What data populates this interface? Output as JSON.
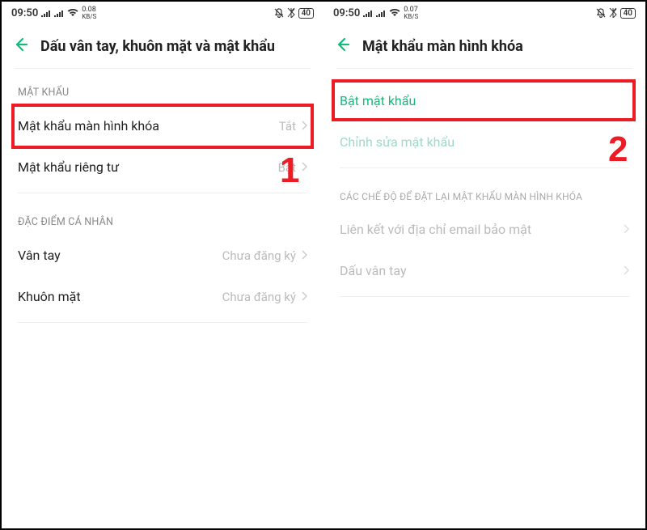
{
  "left": {
    "status": {
      "time": "09:50",
      "kb_top": "0.08",
      "kb_bot": "KB/S",
      "battery": "40"
    },
    "header": {
      "title": "Dấu vân tay, khuôn mặt và mật khẩu"
    },
    "section1": {
      "header": "MẬT KHẨU",
      "item1": {
        "label": "Mật khẩu màn hình khóa",
        "value": "Tắt"
      },
      "item2": {
        "label": "Mật khẩu riêng tư",
        "value": "Bật"
      }
    },
    "section2": {
      "header": "ĐẶC ĐIỂM CÁ NHÂN",
      "item1": {
        "label": "Vân tay",
        "value": "Chưa đăng ký"
      },
      "item2": {
        "label": "Khuôn mặt",
        "value": "Chưa đăng ký"
      }
    },
    "annotation_number": "1"
  },
  "right": {
    "status": {
      "time": "09:50",
      "kb_top": "0.07",
      "kb_bot": "KB/S",
      "battery": "40"
    },
    "header": {
      "title": "Mật khẩu màn hình khóa"
    },
    "item1": {
      "label": "Bật mật khẩu"
    },
    "item2": {
      "label": "Chỉnh sửa mật khẩu"
    },
    "section2": {
      "header": "CÁC CHẾ ĐỘ ĐỂ ĐẶT LẠI MẬT KHẨU MÀN HÌNH KHÓA",
      "item1": {
        "label": "Liên kết với địa chỉ email bảo mật"
      },
      "item2": {
        "label": "Dấu vân tay"
      }
    },
    "annotation_number": "2"
  }
}
